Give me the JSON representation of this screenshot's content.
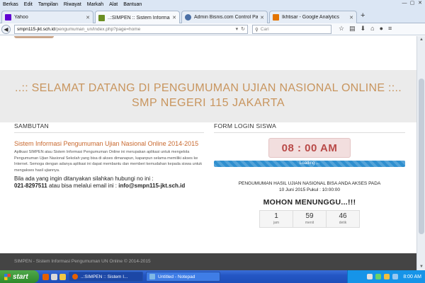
{
  "browser": {
    "menu": [
      "Berkas",
      "Edit",
      "Tampilan",
      "Riwayat",
      "Markah",
      "Alat",
      "Bantuan"
    ],
    "tabs": [
      {
        "label": "Yahoo",
        "favicon_color": "#6001d2",
        "active": false
      },
      {
        "label": "..:SIMPEN :: Sistem Informasi...",
        "favicon_color": "#6b8e23",
        "active": true
      },
      {
        "label": "Admin Bisnis.com Control Pan...",
        "favicon_color": "#4a6fa5",
        "active": false
      },
      {
        "label": "Ikhtisar - Google Analytics",
        "favicon_color": "#e37400",
        "active": false
      }
    ],
    "new_tab": "+",
    "url_host": "smpn115-jkt.sch.id",
    "url_path": "/pengumuman_un/index.php?page=home",
    "search_placeholder": "Cari"
  },
  "page": {
    "banner_line1": "..:: SELAMAT DATANG DI PENGUMUMAN UJIAN NASIONAL ONLINE ::..",
    "banner_line2": "SMP NEGERI 115 JAKARTA",
    "sambutan": {
      "heading": "SAMBUTAN",
      "title": "Sistem Informasi Pengumuman Ujian Nasional Online 2014-2015",
      "body": "Aplikasi SIMPEN atau Sistem Informasi Pengumuman Online ini merupakan aplikasi untuk mengelola Pengumuman Ujian Nasional Sekolah yang bisa di akses dimanapun, kapanpun selama memiliki akses ke Internet. Semoga dengan adanya aplikasi ini dapat membantu dan memberi kemudahan kepada siswa untuk mengakses hasil ujiannya.",
      "contact_line1": "Bila ada yang ingin ditanyakan silahkan hubungi no ini :",
      "contact_phone": "021-8297511",
      "contact_mid": " atau bisa melalui email ini : ",
      "contact_email": "info@smpn115-jkt.sch.id"
    },
    "login": {
      "heading": "FORM LOGIN SISWA",
      "clock": "08 : 00 AM",
      "progress_label": "Loading ...",
      "progress_fraction": 1.0,
      "announce_line1": "PENGUMUMAN HASIL UJIAN NASIONAL BISA ANDA AKSES PADA",
      "announce_line2": "10 Juni 2015 Pukul : 10:00:00",
      "mohon": "MOHON MENUNGGU...!!!",
      "countdown": [
        {
          "value": "1",
          "unit": "jam"
        },
        {
          "value": "59",
          "unit": "menit"
        },
        {
          "value": "46",
          "unit": "detik"
        }
      ]
    },
    "footer": "SIMPEN - Sistem Informasi Pengumuman UN Online © 2014-2015"
  },
  "taskbar": {
    "start": "start",
    "buttons": [
      {
        "label": "..:SIMPEN :: Sistem I...",
        "icon_color": "#e66000",
        "active": true
      },
      {
        "label": "Untitled - Notepad",
        "icon_color": "#7fb8e6",
        "active": false
      }
    ],
    "time": "8:00 AM"
  }
}
